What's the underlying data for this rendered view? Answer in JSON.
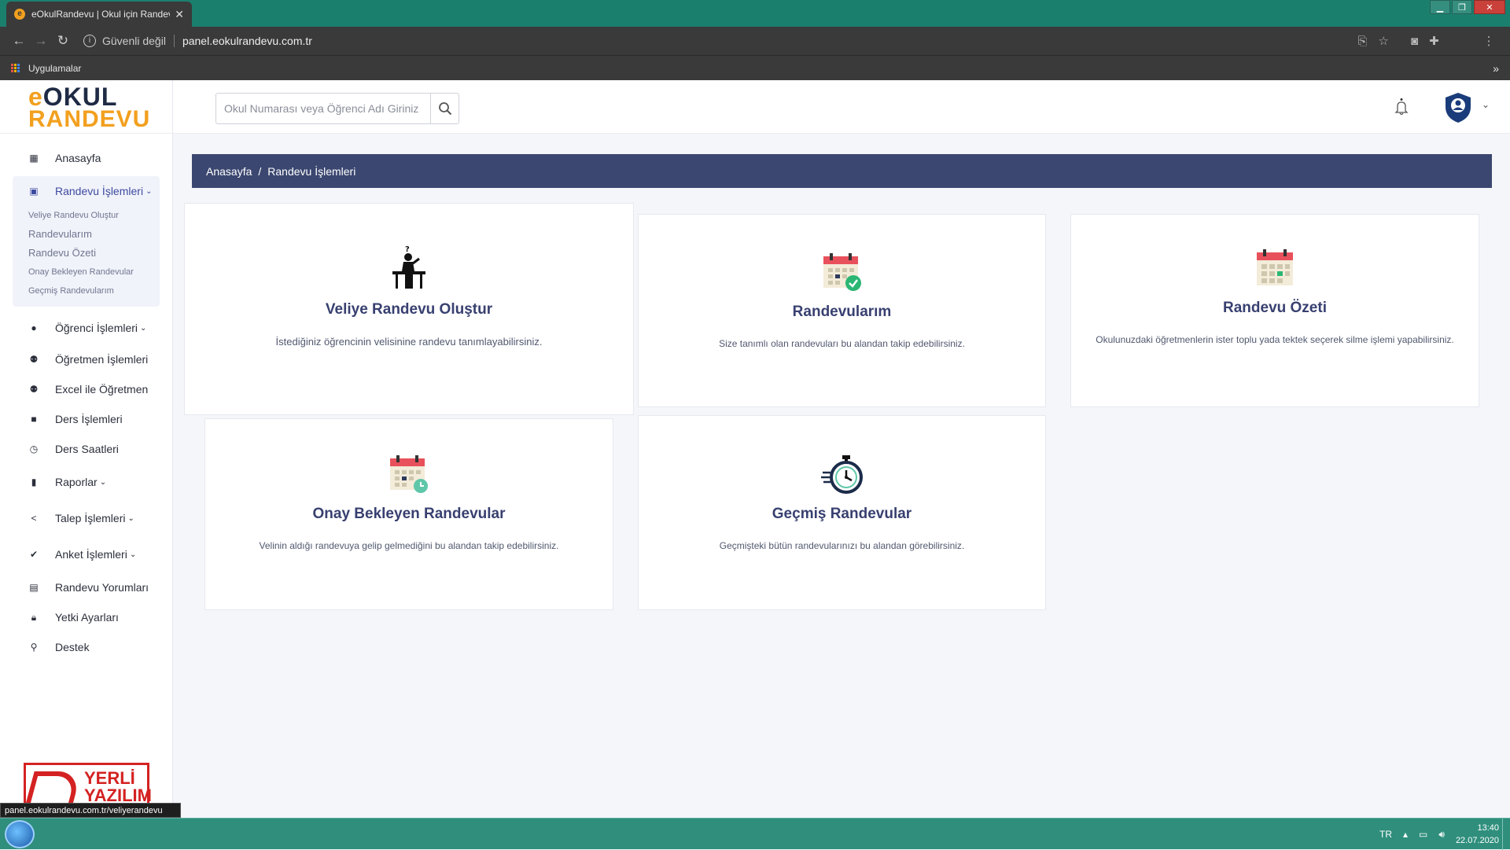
{
  "browser": {
    "tab_title": "eOkulRandevu | Okul için Randevu",
    "tab_favicon": "e",
    "security_label": "Güvenli değil",
    "url": "panel.eokulrandevu.com.tr",
    "bookmarks_label": "Uygulamalar",
    "bookmarks_more": "»",
    "status_url": "panel.eokulrandevu.com.tr/veliyerandevu"
  },
  "logo": {
    "line1_prefix": "e",
    "line1": "OKUL",
    "line2": "RANDEVU"
  },
  "header": {
    "search_placeholder": "Okul Numarası veya Öğrenci Adı Giriniz"
  },
  "sidebar": {
    "home": "Anasayfa",
    "randevu_group": "Randevu İşlemleri",
    "randevu_sub": [
      "Veliye Randevu Oluştur",
      "Randevularım",
      "Randevu Özeti",
      "Onay Bekleyen Randevular",
      "Geçmiş Randevularım"
    ],
    "items": [
      "Öğrenci İşlemleri",
      "Öğretmen İşlemleri",
      "Excel ile Öğretmen",
      "Ders İşlemleri",
      "Ders Saatleri",
      "Raporlar",
      "Talep İşlemleri",
      "Anket İşlemleri",
      "Randevu Yorumları",
      "Yetki Ayarları",
      "Destek"
    ],
    "badge_line1": "YERLİ",
    "badge_line2": "YAZILIM"
  },
  "breadcrumb": {
    "home": "Anasayfa",
    "separator": "/",
    "current": "Randevu İşlemleri"
  },
  "cards": [
    {
      "title": "Veliye Randevu Oluştur",
      "desc": "İstediğiniz öğrencinin velisinine randevu tanımlayabilirsiniz."
    },
    {
      "title": "Randevularım",
      "desc": "Size tanımlı olan randevuları bu alandan takip edebilirsiniz."
    },
    {
      "title": "Randevu Özeti",
      "desc": "Okulunuzdaki öğretmenlerin ister toplu yada tektek seçerek silme işlemi yapabilirsiniz."
    },
    {
      "title": "Onay Bekleyen Randevular",
      "desc": "Velinin aldığı randevuya gelip gelmediğini bu alandan takip edebilirsiniz."
    },
    {
      "title": "Geçmiş Randevular",
      "desc": "Geçmişteki bütün randevularınızı bu alandan görebilirsiniz."
    }
  ],
  "taskbar": {
    "lang": "TR",
    "time": "13:40",
    "date": "22.07.2020"
  },
  "colors": {
    "brand_orange": "#f2a01f",
    "brand_navy": "#3b4770",
    "calendar_red": "#e8515b",
    "check_green": "#2bb673"
  }
}
